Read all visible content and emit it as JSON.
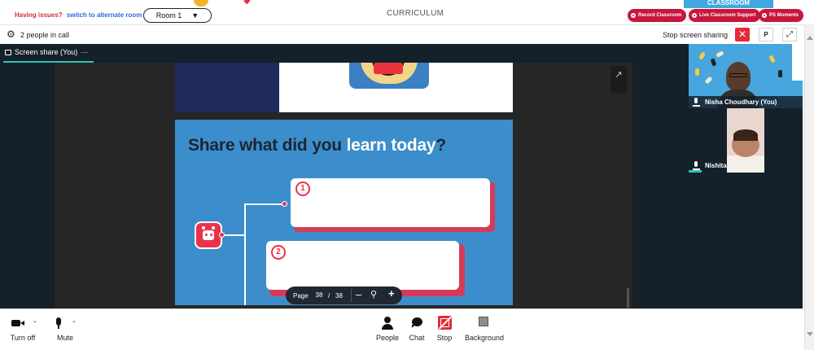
{
  "topbar": {
    "issues_text": "Having issues?",
    "alt_room_link": "switch to alternate room",
    "room_select": "Room 1",
    "title": "CURRICULUM",
    "classroom_tab": "CLASSROOM",
    "buttons": [
      "Record Classroom",
      "Live Classroom Support",
      "PS Moments"
    ]
  },
  "callbar": {
    "people_count": "2 people in call",
    "stop_sharing": "Stop screen sharing",
    "p_button": "P"
  },
  "stage": {
    "tab_label": "Screen share (You)",
    "tab_more": "···"
  },
  "slide": {
    "title_part1": "Share what did you",
    "title_highlight": "learn today",
    "title_end": "?",
    "card1_num": "1",
    "card2_num": "2"
  },
  "pager": {
    "label": "Page",
    "current": "38",
    "separator": "/",
    "total": "38"
  },
  "participants": [
    {
      "name": "Nisha Choudhary (You)"
    },
    {
      "name": "Nishita"
    }
  ],
  "controls": {
    "camera": "Turn off",
    "mic": "Mute",
    "people": "People",
    "chat": "Chat",
    "stop": "Stop",
    "background": "Background"
  },
  "colors": {
    "accent_red": "#c8163c",
    "slide_blue": "#3b8ecb",
    "dark_stage": "#14202a",
    "teal": "#2ec4b6"
  }
}
